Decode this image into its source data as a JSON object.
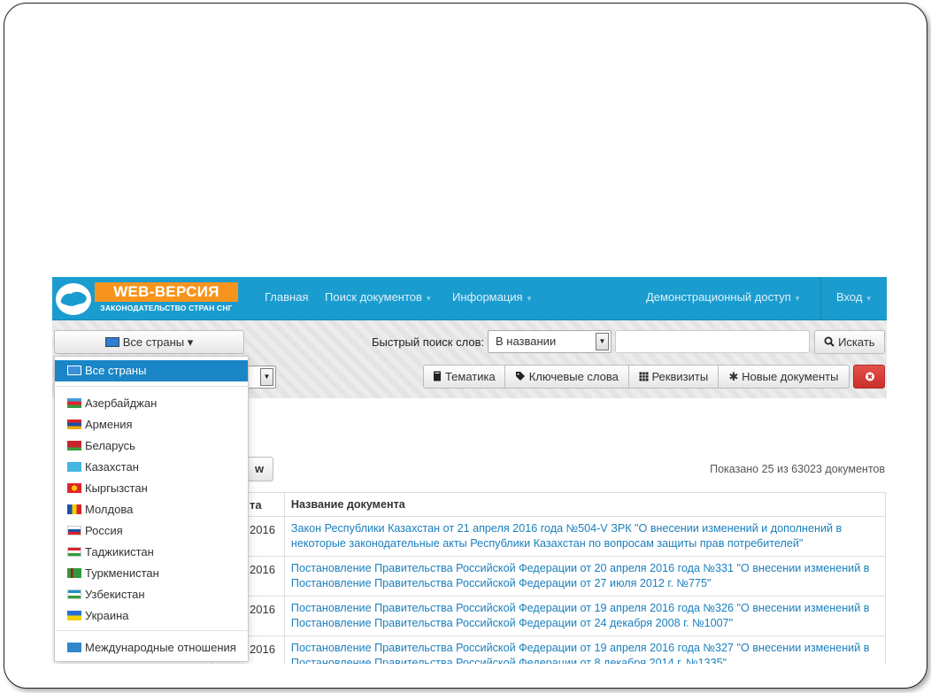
{
  "navbar": {
    "logo_title": "WEB-ВЕРСИЯ",
    "logo_subtitle": "ЗАКОНОДАТЕЛЬСТВО СТРАН СНГ",
    "items": [
      {
        "label": "Главная"
      },
      {
        "label": "Поиск документов",
        "caret": "▾"
      },
      {
        "label": "Информация",
        "caret": "▾"
      },
      {
        "label": "Демонстрационный доступ",
        "caret": "▾"
      },
      {
        "label": "Вход",
        "caret": "▾"
      }
    ]
  },
  "country_select": {
    "label": "Все страны",
    "caret": "▾"
  },
  "quick_search": {
    "label": "Быстрый поиск слов:",
    "scope_value": "В названии",
    "search_value": "",
    "button_label": "Искать"
  },
  "filter_buttons": [
    {
      "label": "Тематика"
    },
    {
      "label": "Ключевые слова"
    },
    {
      "label": "Реквизиты"
    },
    {
      "label": "Новые документы"
    }
  ],
  "w_button_label": "w",
  "results_count": "Показано 25 из 63023 документов",
  "table": {
    "headers": {
      "date": "та",
      "title": "Название документа"
    },
    "rows": [
      {
        "date": "2016",
        "title": "Закон Республики Казахстан от 21 апреля 2016 года №504-V ЗРК \"О внесении изменений и дополнений в некоторые законодательные акты Республики Казахстан по вопросам защиты прав потребителей\""
      },
      {
        "date": "2016",
        "title": "Постановление Правительства Российской Федерации от 20 апреля 2016 года №331 \"О внесении изменений в Постановление Правительства Российской Федерации от 27 июля 2012 г. №775\""
      },
      {
        "date": "2016",
        "title": "Постановление Правительства Российской Федерации от 19 апреля 2016 года №326 \"О внесении изменений в Постановление Правительства Российской Федерации от 24 декабря 2008 г. №1007\""
      },
      {
        "date": "2016",
        "title": "Постановление Правительства Российской Федерации от 19 апреля 2016 года №327 \"О внесении изменений в Постановление Правительства Российской Федерации от 8 декабря 2014 г. №1335\""
      }
    ]
  },
  "dropdown": {
    "all": "Все страны",
    "countries": [
      "Азербайджан",
      "Армения",
      "Беларусь",
      "Казахстан",
      "Кыргызстан",
      "Молдова",
      "Россия",
      "Таджикистан",
      "Туркменистан",
      "Узбекистан",
      "Украина"
    ],
    "international": "Международные отношения"
  },
  "colors": {
    "navbar": "#1a9ccf",
    "accent": "#1a86c6",
    "logo_badge": "#f7941d",
    "danger": "#d9534f",
    "link": "#1a7fbd"
  }
}
